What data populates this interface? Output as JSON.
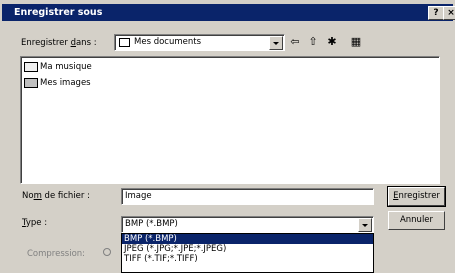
{
  "window": {
    "title": "Enregistrer sous"
  },
  "titlebar": {
    "help_glyph": "?",
    "close_glyph": "×"
  },
  "save_in": {
    "label_pre": "Enregistrer ",
    "label_underlined": "d",
    "label_post": "ans :",
    "value": "Mes documents"
  },
  "toolbar": {
    "back_glyph": "⇦",
    "up_glyph": "⇧",
    "new_folder_glyph": "✱",
    "view_glyph": "▦"
  },
  "files": [
    {
      "name": "Ma musique",
      "icon": "folder-music-icon"
    },
    {
      "name": "Mes images",
      "icon": "folder-pictures-icon"
    }
  ],
  "filename": {
    "label_pre": "No",
    "label_underlined": "m",
    "label_post": " de fichier :",
    "value": "Image"
  },
  "filetype": {
    "label_underlined": "T",
    "label_post": "ype :",
    "value": "BMP (*.BMP)",
    "options": [
      "BMP (*.BMP)",
      "JPEG (*.JPG;*.JPE;*.JPEG)",
      "TIFF (*.TIF;*.TIFF)"
    ]
  },
  "buttons": {
    "save_underlined": "E",
    "save_rest": "nregistrer",
    "cancel": "Annuler"
  },
  "compression": {
    "label": "Compression:"
  }
}
